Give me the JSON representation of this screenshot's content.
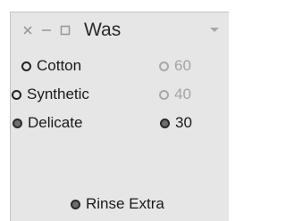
{
  "window": {
    "title": "Was",
    "controls": {
      "close": "close-icon",
      "minimize": "minimize-icon",
      "maximize": "maximize-icon",
      "menu": "menu-dropdown-icon"
    }
  },
  "program": {
    "options": [
      {
        "label": "Cotton",
        "selected": false
      },
      {
        "label": "Synthetic",
        "selected": false
      },
      {
        "label": "Delicate",
        "selected": true
      }
    ]
  },
  "temperature": {
    "options": [
      {
        "label": "60",
        "selected": false,
        "enabled": false
      },
      {
        "label": "40",
        "selected": false,
        "enabled": false
      },
      {
        "label": "30",
        "selected": true,
        "enabled": true
      }
    ]
  },
  "extras": {
    "rinse_extra": {
      "label": "Rinse Extra",
      "selected": true
    }
  },
  "colors": {
    "window_bg": "#e6e6e6",
    "text": "#1a1a1a",
    "disabled_text": "#a4a4a4",
    "selected_fill": "#6e6e6e"
  }
}
